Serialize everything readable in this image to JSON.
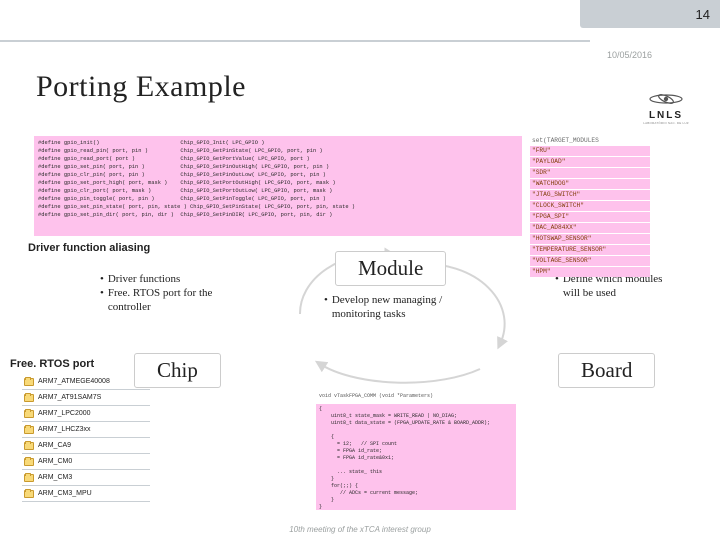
{
  "page_number": "14",
  "date": "10/05/2016",
  "title": "Porting Example",
  "logo": {
    "text": "LNLS",
    "sub": "LABORATÓRIO NAC. DE LUZ"
  },
  "labels": {
    "driver_aliasing": "Driver function aliasing",
    "freertos_port": "Free. RTOS port"
  },
  "chip": {
    "heading": "Chip",
    "bullets": [
      "Driver functions",
      "Free. RTOS port for the controller"
    ]
  },
  "module": {
    "heading": "Module",
    "bullets": [
      "Develop new managing / monitoring tasks"
    ]
  },
  "board": {
    "heading": "Board",
    "bullets": [
      "Define which modules will be used"
    ]
  },
  "code_defines": "#define gpio_init()                         Chip_GPIO_Init( LPC_GPIO )\n#define gpio_read_pin( port, pin )          Chip_GPIO_GetPinState( LPC_GPIO, port, pin )\n#define gpio_read_port( port )              Chip_GPIO_GetPortValue( LPC_GPIO, port )\n#define gpio_set_pin( port, pin )           Chip_GPIO_SetPinOutHigh( LPC_GPIO, port, pin )\n#define gpio_clr_pin( port, pin )           Chip_GPIO_SetPinOutLow( LPC_GPIO, port, pin )\n#define gpio_set_port_high( port, mask )    Chip_GPIO_SetPortOutHigh( LPC_GPIO, port, mask )\n#define gpio_clr_port( port, mask )         Chip_GPIO_SetPortOutLow( LPC_GPIO, port, mask )\n#define gpio_pin_toggle( port, pin )        Chip_GPIO_SetPinToggle( LPC_GPIO, port, pin )\n#define gpio_set_pin_state( port, pin, state ) Chip_GPIO_SetPinState( LPC_GPIO, port, pin, state )\n#define gpio_set_pin_dir( port, pin, dir )  Chip_GPIO_SetPinDIR( LPC_GPIO, port, pin, dir )",
  "module_list": {
    "heading": "set(TARGET_MODULES",
    "items": [
      "\"FRU\"",
      "\"PAYLOAD\"",
      "\"SDR\"",
      "\"WATCHDOG\"",
      "\"JTAG_SWITCH\"",
      "\"CLOCK_SWITCH\"",
      "\"FPGA_SPI\"",
      "\"DAC_AD84XX\"",
      "\"HOTSWAP_SENSOR\"",
      "\"TEMPERATURE_SENSOR\"",
      "\"VOLTAGE_SENSOR\"",
      "\"HPM\""
    ]
  },
  "folders": [
    "ARM7_ATMEGE40008",
    "ARM7_AT91SAM7S",
    "ARM7_LPC2000",
    "ARM7_LHCZ3xx",
    "ARM_CA9",
    "ARM_CM0",
    "ARM_CM3",
    "ARM_CM3_MPU"
  ],
  "code_task_header": "void vTaskFPGA_COMM (void *Parameters)",
  "code_task": "{\n    uint8_t state_mask = WRITE_READ | NO_DIAG;\n    uint8_t data_state = (FPGA_UPDATE_RATE & BOARD_ADDR);\n\n    {\n      = 12;   // SPI count\n      = FPGA id_rate;\n      = FPGA id_rate&0x1;\n\n      ... state_ this\n    }\n    for(;;) {\n       // ADCs = current message;\n    }\n}",
  "footer": "10th meeting of the xTCA interest group"
}
